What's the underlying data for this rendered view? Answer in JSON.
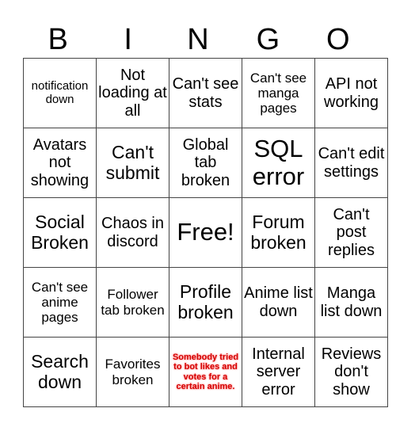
{
  "header": [
    "B",
    "I",
    "N",
    "G",
    "O"
  ],
  "rows": [
    [
      "notification down",
      "Not loading at all",
      "Can't see stats",
      "Can't see manga pages",
      "API not working"
    ],
    [
      "Avatars not showing",
      "Can't submit",
      "Global tab broken",
      "SQL error",
      "Can't edit settings"
    ],
    [
      "Social Broken",
      "Chaos in discord",
      "Free!",
      "Forum broken",
      "Can't post replies"
    ],
    [
      "Can't see anime pages",
      "Follower tab broken",
      "Profile broken",
      "Anime list down",
      "Manga list down"
    ],
    [
      "Search down",
      "Favorites broken",
      "Somebody tried to bot likes and votes for a certain anime.",
      "Internal server error",
      "Reviews don't show"
    ]
  ],
  "colors": {
    "highlight_text": "#d40000",
    "grid": "#444444"
  }
}
